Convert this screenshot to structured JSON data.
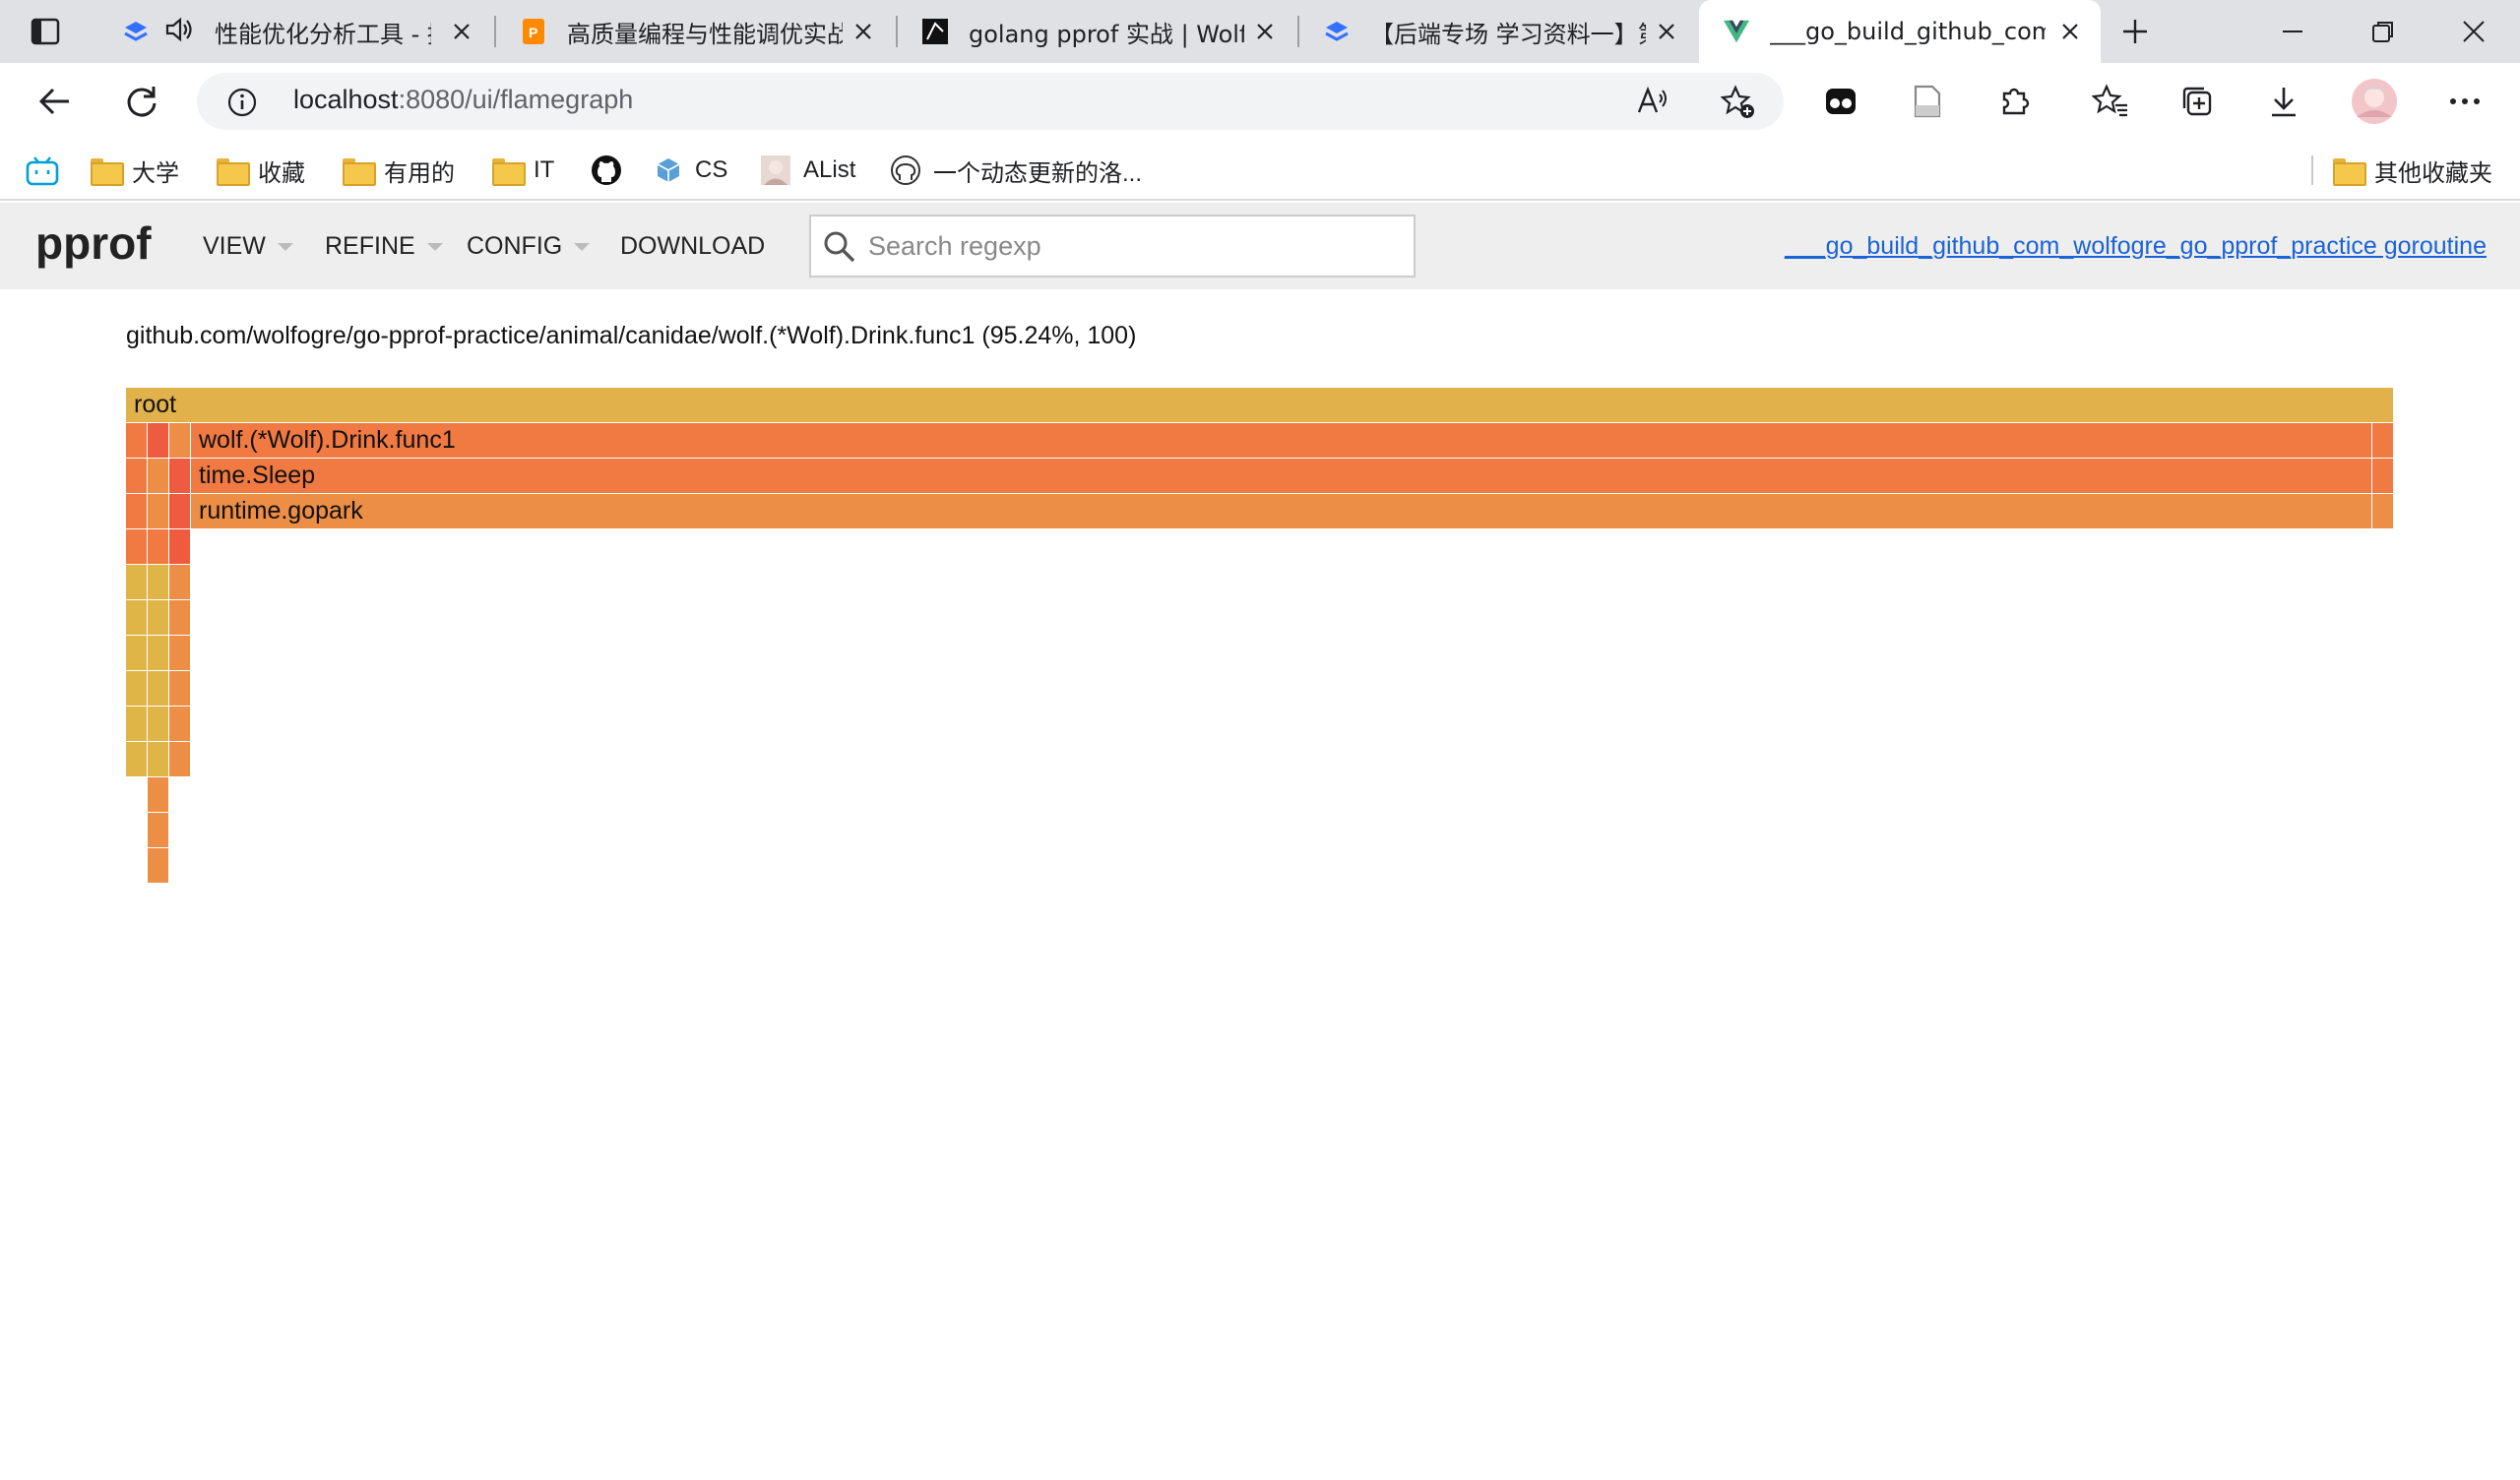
{
  "browser": {
    "tabs": [
      {
        "title": "性能优化分析工具 - 掘",
        "favicon": "lark-doc-icon",
        "audio": true
      },
      {
        "title": "高质量编程与性能调优实战",
        "favicon": "ppt-icon"
      },
      {
        "title": "golang pprof 实战 | Wolfo",
        "favicon": "wolfogre-icon"
      },
      {
        "title": "【后端专场 学习资料一】第",
        "favicon": "lark-doc-icon"
      },
      {
        "title": "___go_build_github_com_w",
        "favicon": "vue-icon",
        "active": true
      }
    ],
    "address": {
      "host": "localhost",
      "path": ":8080/ui/flamegraph"
    },
    "bookmarks": [
      {
        "label": "",
        "icon": "bilibili-icon"
      },
      {
        "label": "大学",
        "icon": "folder-icon"
      },
      {
        "label": "收藏",
        "icon": "folder-icon"
      },
      {
        "label": "有用的",
        "icon": "folder-icon"
      },
      {
        "label": "IT",
        "icon": "folder-icon"
      },
      {
        "label": "",
        "icon": "github-icon"
      },
      {
        "label": "CS",
        "icon": "cube-icon"
      },
      {
        "label": "AList",
        "icon": "avatar-icon"
      },
      {
        "label": "一个动态更新的洛...",
        "icon": "octocat-icon"
      }
    ],
    "other_bookmarks": "其他收藏夹"
  },
  "pprof": {
    "logo": "pprof",
    "menu": [
      "VIEW",
      "REFINE",
      "CONFIG",
      "DOWNLOAD"
    ],
    "search_placeholder": "Search regexp",
    "binary_link": "___go_build_github_com_wolfogre_go_pprof_practice goroutine"
  },
  "flamegraph": {
    "details": "github.com/wolfogre/go-pprof-practice/animal/canidae/wolf.(*Wolf).Drink.func1 (95.24%, 100)",
    "frames": [
      {
        "label": "root",
        "color": "#e1b14c"
      },
      {
        "label": "wolf.(*Wolf).Drink.func1",
        "color": "#f07a42"
      },
      {
        "label": "time.Sleep",
        "color": "#f07a42"
      },
      {
        "label": "runtime.gopark",
        "color": "#ec8e45"
      }
    ],
    "colors": {
      "root": "#e1b14c",
      "hot": "#f07a42",
      "warm": "#ec8e45",
      "mustard": "#e0b547",
      "red": "#ef5b3f"
    }
  }
}
